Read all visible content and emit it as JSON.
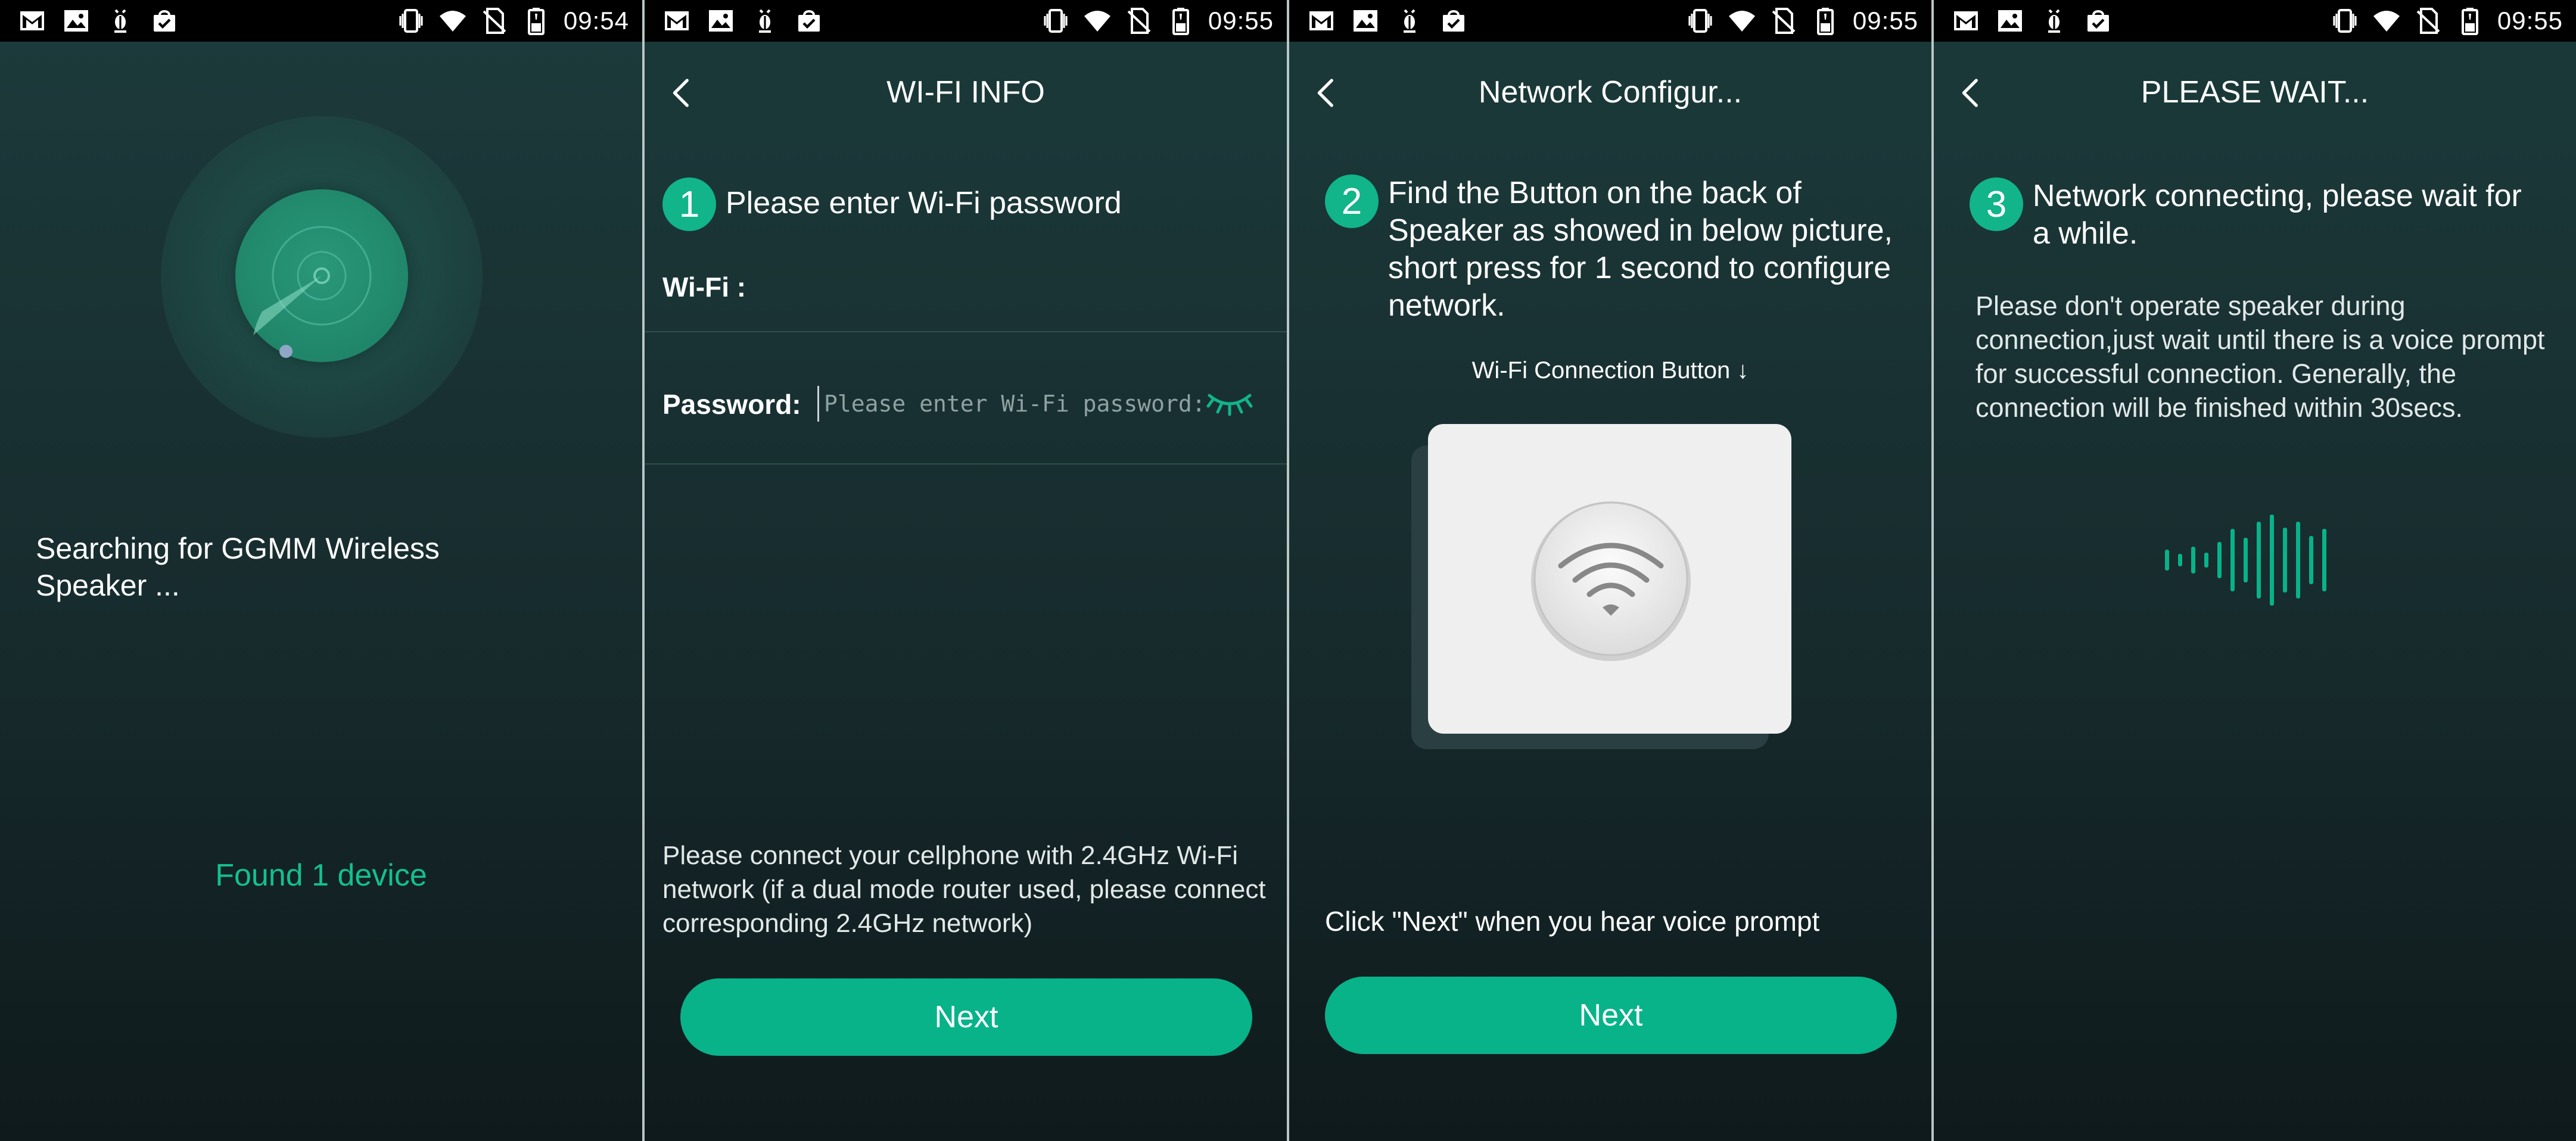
{
  "status_bar": [
    {
      "time": "09:54"
    },
    {
      "time": "09:55"
    },
    {
      "time": "09:55"
    },
    {
      "time": "09:55"
    }
  ],
  "screen1": {
    "searching_text": "Searching for GGMM Wireless Speaker ...",
    "found_text": "Found 1 device"
  },
  "screen2": {
    "title": "WI-FI INFO",
    "step_number": "1",
    "step_text": "Please enter Wi-Fi password",
    "wifi_label": "Wi-Fi :",
    "password_label": "Password:",
    "password_placeholder": "Please enter Wi-Fi password:",
    "note": "Please connect your cellphone with 2.4GHz Wi-Fi network (if a dual mode router used, please connect corresponding 2.4GHz network)",
    "next_label": "Next"
  },
  "screen3": {
    "title": "Network Configur...",
    "step_number": "2",
    "step_text": "Find the Button on the back of Speaker as showed in below picture, short press for 1 second to configure network.",
    "button_caption": "Wi-Fi Connection Button ↓",
    "voice_note": "Click \"Next\" when you hear voice prompt",
    "next_label": "Next"
  },
  "screen4": {
    "title": "PLEASE WAIT...",
    "step_number": "3",
    "step_text": "Network connecting, please wait for a while.",
    "note": "Please don't operate speaker during connection,just wait until there is a voice prompt for successful connection. Generally, the connection will be finished within 30secs."
  },
  "colors": {
    "accent": "#08b38a",
    "found_text": "#14c08e",
    "navbar": "#1a3838",
    "status_bar": "#000000"
  },
  "icons": {
    "status_left": [
      "gmail-icon",
      "image-icon",
      "bug-icon",
      "shopping-bag-icon"
    ],
    "status_right": [
      "vibrate-icon",
      "wifi-icon",
      "no-sim-icon",
      "battery-icon"
    ],
    "nav": "back-arrow-icon",
    "password_toggle": "eye-closed-icon",
    "button_illustration": "wifi-icon",
    "progress": "sound-wave-icon"
  }
}
